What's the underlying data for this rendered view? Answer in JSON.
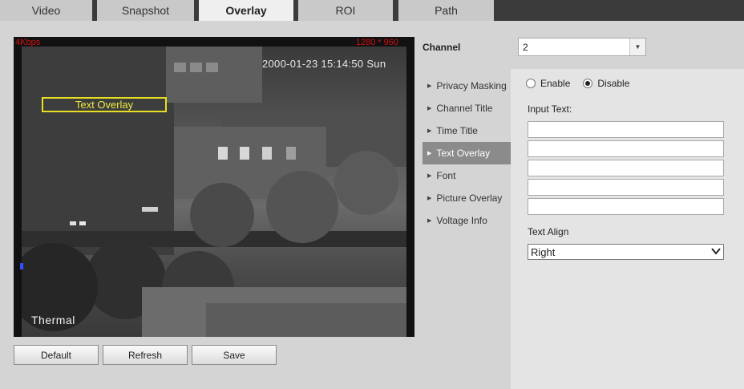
{
  "tabs": [
    {
      "label": "Video",
      "active": false
    },
    {
      "label": "Snapshot",
      "active": false
    },
    {
      "label": "Overlay",
      "active": true
    },
    {
      "label": "ROI",
      "active": false
    },
    {
      "label": "Path",
      "active": false
    }
  ],
  "video": {
    "bitrate": "4Kbps",
    "resolution": "1280 * 960",
    "timestamp": "2000-01-23 15:14:50 Sun",
    "overlay_text": "Text Overlay",
    "channel_title": "Thermal"
  },
  "buttons": {
    "default": "Default",
    "refresh": "Refresh",
    "save": "Save"
  },
  "channel": {
    "label": "Channel",
    "value": "2"
  },
  "menu": [
    {
      "label": "Privacy Masking",
      "active": false
    },
    {
      "label": "Channel Title",
      "active": false
    },
    {
      "label": "Time Title",
      "active": false
    },
    {
      "label": "Text Overlay",
      "active": true
    },
    {
      "label": "Font",
      "active": false
    },
    {
      "label": "Picture Overlay",
      "active": false
    },
    {
      "label": "Voltage Info",
      "active": false
    }
  ],
  "text_overlay": {
    "enable_label": "Enable",
    "disable_label": "Disable",
    "selected": "Disable",
    "input_label": "Input Text:",
    "inputs": [
      "",
      "",
      "",
      "",
      ""
    ],
    "align_label": "Text Align",
    "align_value": "Right"
  },
  "colors": {
    "tab_bar": "#3b3b3b",
    "active_menu": "#8b8b8b",
    "overlay_box": "#e6e020",
    "osd_red": "#d21010"
  }
}
